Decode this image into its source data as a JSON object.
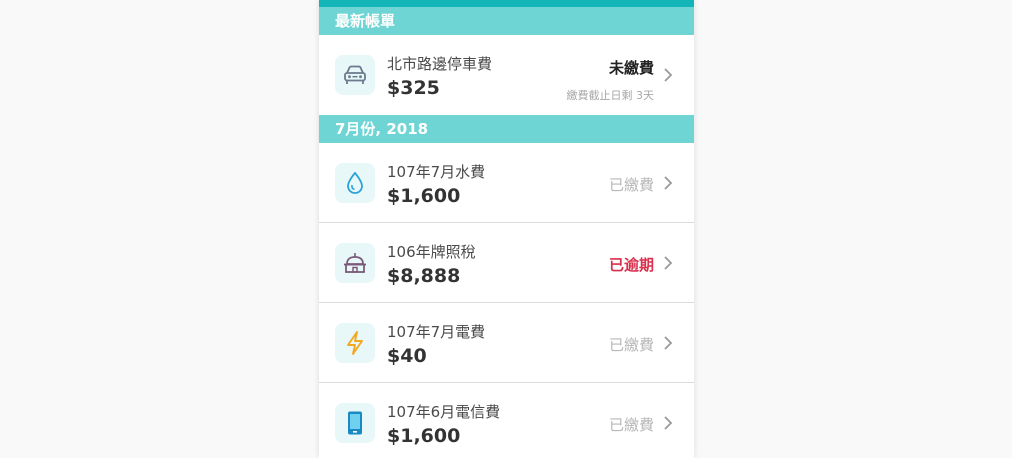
{
  "sections": {
    "latest": {
      "title": "最新帳單",
      "items": [
        {
          "name": "北市路邊停車費",
          "amount": "$325",
          "status": "未繳費",
          "due_note": "繳費截止日剩 3天",
          "icon": "car-icon"
        }
      ]
    },
    "july": {
      "title": "7月份, 2018",
      "items": [
        {
          "name": "107年7月水費",
          "amount": "$1,600",
          "status": "已繳費",
          "icon": "water-drop-icon"
        },
        {
          "name": "106年牌照稅",
          "amount": "$8,888",
          "status": "已逾期",
          "icon": "government-building-icon"
        },
        {
          "name": "107年7月電費",
          "amount": "$40",
          "status": "已繳費",
          "icon": "lightning-icon"
        },
        {
          "name": "107年6月電信費",
          "amount": "$1,600",
          "status": "已繳費",
          "icon": "mobile-phone-icon"
        }
      ]
    }
  },
  "colors": {
    "header_teal": "#6fd5d4",
    "top_strip": "#13b5b8",
    "overdue_red": "#d9304e",
    "paid_gray": "#b7b7b7",
    "icon_bg": "#e8f7f7"
  }
}
